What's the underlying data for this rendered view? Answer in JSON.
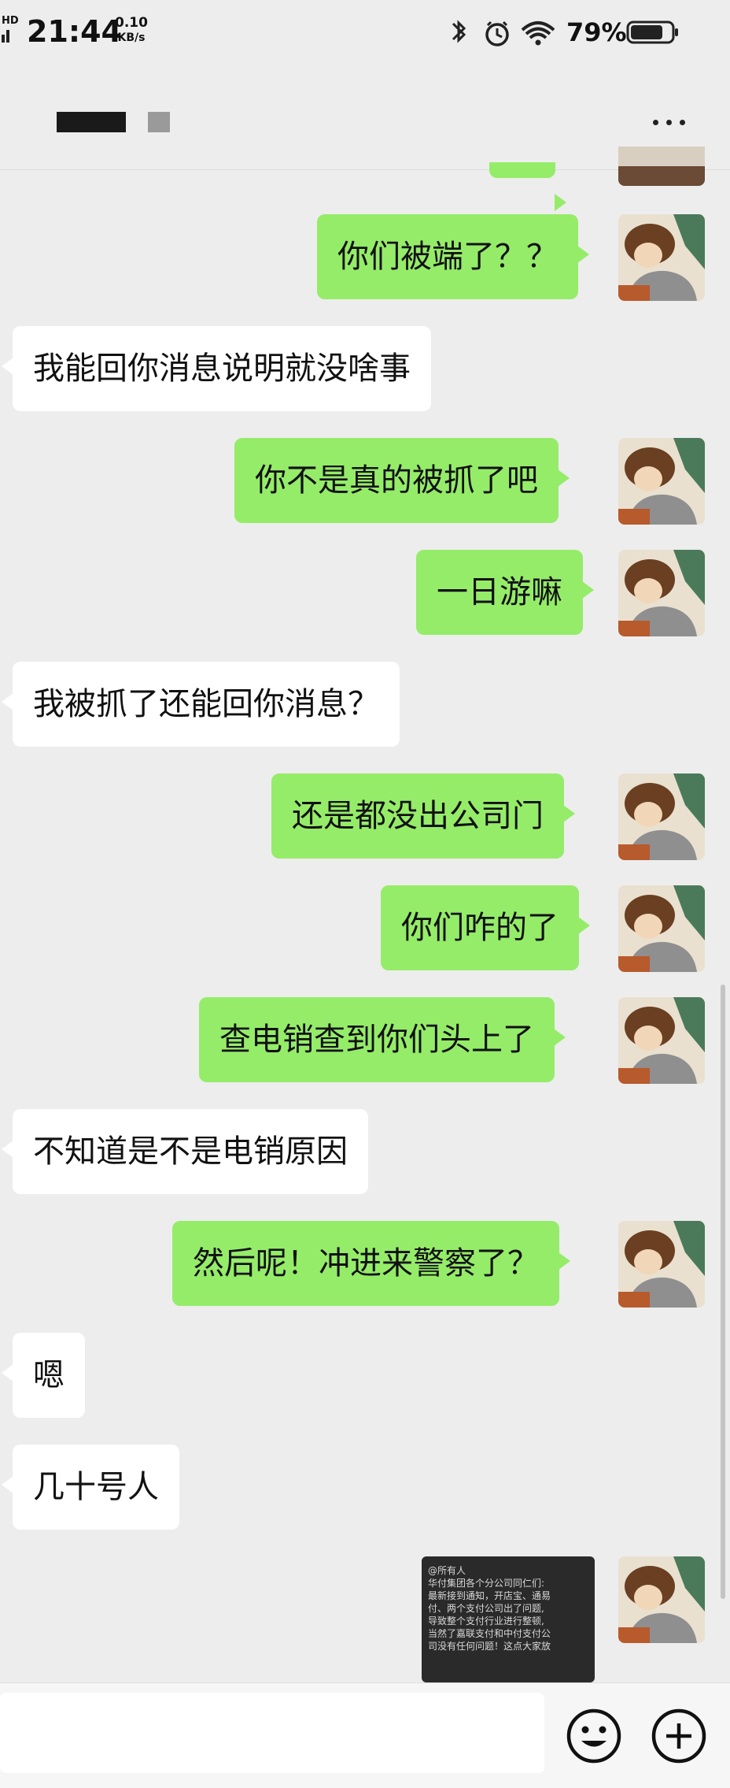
{
  "status_bar": {
    "network_badge": "HD",
    "time": "21:44",
    "speed_value": "0.10",
    "speed_unit": "KB/s",
    "battery": "79%",
    "icons": [
      "bluetooth-icon",
      "alarm-icon",
      "wifi-icon",
      "battery-icon"
    ]
  },
  "header": {
    "title": "",
    "more_icon": "more-dots-icon"
  },
  "messages": [
    {
      "side": "right",
      "text": ""
    },
    {
      "side": "right",
      "text": "你们被端了？？"
    },
    {
      "side": "left",
      "text": "我能回你消息说明就没啥事"
    },
    {
      "side": "right",
      "text": "你不是真的被抓了吧"
    },
    {
      "side": "right",
      "text": "一日游嘛"
    },
    {
      "side": "left",
      "text": "我被抓了还能回你消息？"
    },
    {
      "side": "right",
      "text": "还是都没出公司门"
    },
    {
      "side": "right",
      "text": "你们咋的了"
    },
    {
      "side": "right",
      "text": "查电销查到你们头上了"
    },
    {
      "side": "left",
      "text": "不知道是不是电销原因"
    },
    {
      "side": "right",
      "text": "然后呢！冲进来警察了？"
    },
    {
      "side": "left",
      "text": "嗯"
    },
    {
      "side": "left",
      "text": "几十号人"
    }
  ],
  "image_message": {
    "lines": [
      "@所有人",
      "华付集团各个分公司同仁们:",
      "最新接到通知，开店宝、通易",
      "付、两个支付公司出了问题,",
      "导致整个支付行业进行整顿,",
      "当然了嘉联支付和中付支付公",
      "司没有任何问题！这点大家放"
    ]
  },
  "input_bar": {
    "placeholder": "",
    "emoji_icon": "emoji-icon",
    "plus_icon": "plus-icon"
  },
  "colors": {
    "background": "#ededed",
    "sent_bubble": "#95ec69",
    "received_bubble": "#ffffff"
  }
}
